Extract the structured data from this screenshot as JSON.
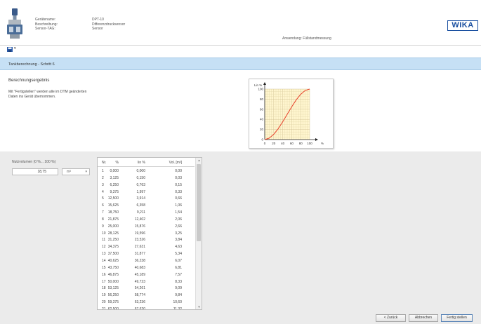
{
  "header": {
    "label_device_name": "Gerätename:",
    "label_description": "Beschreibung:",
    "label_sensor_tag": "Sensor-TAG:",
    "device_name": "DPT-10",
    "description": "Differenzdrucksensor",
    "sensor_tag": "Sensor",
    "application": "Anwendung: Füllstandmessung",
    "logo_text": "WIKA"
  },
  "toolbar": {
    "save_icon": "save-icon",
    "dropdown_caret": "▾"
  },
  "section": {
    "title": "Tankberechnung - Schritt 6"
  },
  "result": {
    "title": "Berechnungsergebnis",
    "desc_line1": "Mit \"Fertigstellen\" werden alle im DTM geänderten",
    "desc_line2": "Daten ins Gerät übernommen."
  },
  "chart_data": {
    "type": "line",
    "ylabel": "Lin %",
    "xlabel": "%",
    "x_ticks": [
      "0",
      "20",
      "40",
      "60",
      "80",
      "100"
    ],
    "y_ticks": [
      "0",
      "20",
      "40",
      "60",
      "80",
      "100"
    ],
    "xlim": [
      0,
      100
    ],
    "ylim": [
      0,
      100
    ],
    "grid": true,
    "series": [
      {
        "color": "#e8402a",
        "x": [
          0,
          10,
          20,
          30,
          40,
          50,
          60,
          70,
          80,
          90,
          100
        ],
        "y": [
          0,
          2.8,
          10.4,
          21.5,
          35.2,
          50,
          64.8,
          78.5,
          89.6,
          97.2,
          100
        ]
      }
    ]
  },
  "volume": {
    "label": "Nutzvolumen (0 %... 100 %)",
    "value": "18,75",
    "unit": "m³",
    "caret": "▾"
  },
  "table": {
    "headers": [
      "Nr.",
      "%",
      "lin %",
      "Vol. [m³]"
    ],
    "rows": [
      [
        "1",
        "0,000",
        "0,000",
        "0,00"
      ],
      [
        "2",
        "3,125",
        "0,150",
        "0,03"
      ],
      [
        "3",
        "6,250",
        "0,763",
        "0,15"
      ],
      [
        "4",
        "9,375",
        "1,997",
        "0,33"
      ],
      [
        "5",
        "12,500",
        "3,914",
        "0,66"
      ],
      [
        "6",
        "15,625",
        "6,358",
        "1,06"
      ],
      [
        "7",
        "18,750",
        "9,211",
        "1,54"
      ],
      [
        "8",
        "21,875",
        "12,402",
        "2,06"
      ],
      [
        "9",
        "25,000",
        "15,876",
        "2,66"
      ],
      [
        "10",
        "28,125",
        "19,596",
        "3,25"
      ],
      [
        "11",
        "31,250",
        "23,526",
        "3,84"
      ],
      [
        "12",
        "34,375",
        "27,631",
        "4,63"
      ],
      [
        "13",
        "37,500",
        "31,877",
        "5,34"
      ],
      [
        "14",
        "40,625",
        "36,238",
        "6,07"
      ],
      [
        "15",
        "43,750",
        "40,683",
        "6,81"
      ],
      [
        "16",
        "46,875",
        "45,189",
        "7,57"
      ],
      [
        "17",
        "50,000",
        "49,723",
        "8,33"
      ],
      [
        "18",
        "53,125",
        "54,261",
        "9,09"
      ],
      [
        "19",
        "56,250",
        "58,774",
        "9,84"
      ],
      [
        "20",
        "59,375",
        "63,236",
        "10,60"
      ],
      [
        "21",
        "62,500",
        "67,620",
        "11,32"
      ]
    ],
    "scroll_up": "▲",
    "scroll_down": "▼"
  },
  "buttons": {
    "back": "< Zurück",
    "cancel": "Abbrechen",
    "finish": "Fertig stellen"
  }
}
